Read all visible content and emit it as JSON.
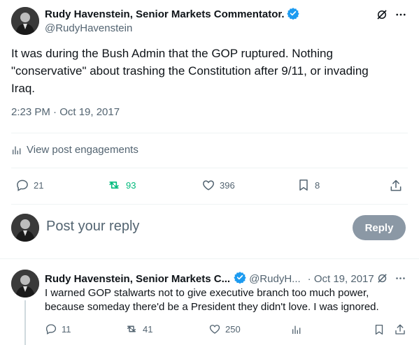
{
  "main_tweet": {
    "author_name": "Rudy Havenstein, Senior Markets Commentator.",
    "handle": "@RudyHavenstein",
    "text": "It was during the Bush Admin that the GOP ruptured. Nothing \"conservative\" about trashing the Constitution after 9/11, or invading Iraq.",
    "timestamp": "2:23 PM · Oct 19, 2017",
    "engagements_label": "View post engagements",
    "replies": "21",
    "retweets": "93",
    "likes": "396",
    "bookmarks": "8"
  },
  "composer": {
    "placeholder": "Post your reply",
    "button_label": "Reply"
  },
  "reply_tweet": {
    "author_name": "Rudy Havenstein, Senior Markets C...",
    "handle": "@RudyH...",
    "date": "· Oct 19, 2017",
    "text": "I warned GOP stalwarts not to give executive branch too much power, because someday there'd be a President they didn't love. I was ignored.",
    "replies": "11",
    "retweets": "41",
    "likes": "250"
  },
  "colors": {
    "verified": "#1d9bf0",
    "retweet_active": "#00ba7c",
    "muted": "#536471",
    "reply_button_bg": "#8b98a5"
  }
}
